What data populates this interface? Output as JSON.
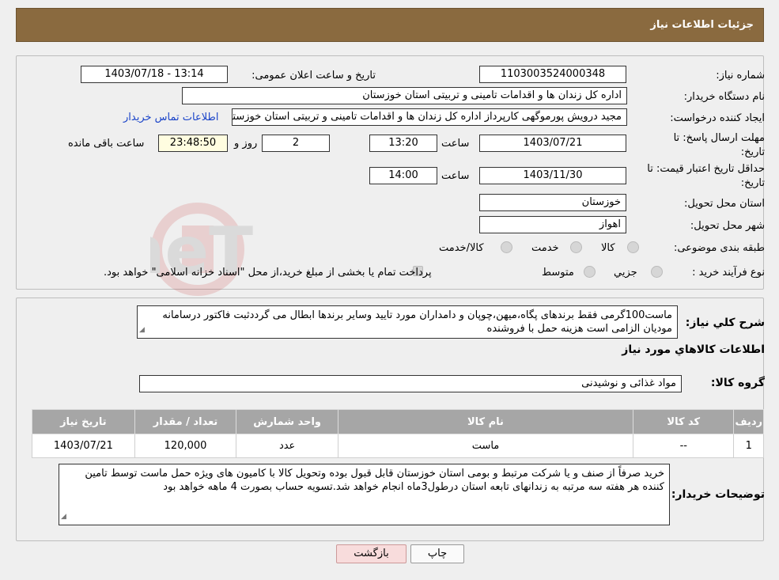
{
  "header": {
    "title": "جزئیات اطلاعات نیاز"
  },
  "labels": {
    "need_number": "شماره نیاز:",
    "announce_datetime": "تاریخ و ساعت اعلان عمومی:",
    "buyer_org": "نام دستگاه خریدار:",
    "requester": "ایجاد کننده درخواست:",
    "reply_deadline": "مهلت ارسال پاسخ: تا تاریخ:",
    "time": "ساعت",
    "days": "روز و",
    "remaining": "ساعت باقی مانده",
    "price_validity": "حداقل تاریخ اعتبار قیمت: تا تاریخ:",
    "delivery_province": "استان محل تحویل:",
    "delivery_city": "شهر محل تحویل:",
    "category": "طبقه بندی موضوعی:",
    "purchase_type": "نوع فرآیند خرید :",
    "general_description": "شرح کلي نياز:",
    "goods_info": "اطلاعات کالاهاي مورد نياز",
    "goods_group": "گروه کالا:",
    "buyer_notes": "توضیحات خریدار:"
  },
  "fields": {
    "need_number": "1103003524000348",
    "announce_datetime": "1403/07/18 - 13:14",
    "buyer_org": "اداره کل زندان ها و اقدامات تامینی و تربیتی استان خوزستان",
    "requester": "مجید درویش پورموگهی کارپرداز اداره کل زندان ها و اقدامات تامینی و تربیتی استان خوزستان",
    "contact_link": "اطلاعات تماس خریدار",
    "reply_date": "1403/07/21",
    "reply_time": "13:20",
    "reply_days": "2",
    "remaining_time": "23:48:50",
    "validity_date": "1403/11/30",
    "validity_time": "14:00",
    "province": "خوزستان",
    "city": "اهواز",
    "goods_group": "مواد غذائی و نوشیدنی"
  },
  "category_options": [
    "کالا",
    "خدمت",
    "کالا/خدمت"
  ],
  "purchase_options": [
    "جزیي",
    "متوسط"
  ],
  "purchase_note": "پرداخت تمام یا بخشی از مبلغ خرید،از محل \"اسناد خزانه اسلامی\" خواهد بود.",
  "general_description": "ماست100گرمی فقط برندهای پگاه،میهن،چوپان و دامداران مورد تایید وسایر برندها ابطال می گرددثبت فاکتور درسامانه مودیان الزامی است هزینه حمل با فروشنده",
  "table": {
    "headers": [
      "ردیف",
      "کد کالا",
      "نام کالا",
      "واحد شمارش",
      "تعداد / مقدار",
      "تاریخ نیاز"
    ],
    "rows": [
      [
        "1",
        "--",
        "ماست",
        "عدد",
        "120,000",
        "1403/07/21"
      ]
    ]
  },
  "buyer_notes": "خرید صرفاً از صنف و یا شرکت مرتبط  و بومی استان خوزستان قابل قبول بوده وتحویل کالا با کامیون های ویژه حمل ماست  توسط تامین کننده هر هفته سه مرتبه به زندانهای تابعه استان درطول3ماه انجام خواهد شد.تسویه حساب بصورت 4 ماهه خواهد بود",
  "buttons": {
    "print": "چاپ",
    "back": "بازگشت"
  },
  "watermark": {
    "text": "AriaTender.neT"
  },
  "colors": {
    "header": "#8a6a3f",
    "link": "#1a44c9",
    "table_header": "#a6a6a6",
    "back_button": "#f8dcdc"
  }
}
